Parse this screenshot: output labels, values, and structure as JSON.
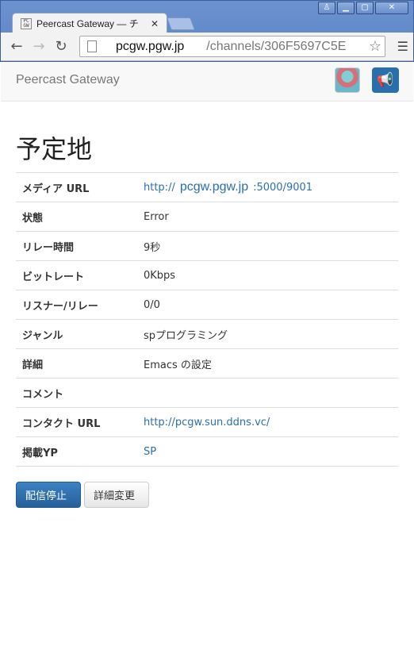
{
  "browser": {
    "tab_title": "Peercast Gateway — チ",
    "tab_favicon_text": "PC GW",
    "omnibox_host": "pcgw.pgw.jp",
    "omnibox_path": "/channels/306F5697C5E"
  },
  "navbar": {
    "brand": "Peercast Gateway"
  },
  "page": {
    "title": "予定地"
  },
  "info": {
    "media_url": {
      "label": "メディア URL",
      "prefix": "http://",
      "host": "pcgw.pgw.jp",
      "suffix": ":5000/9001"
    },
    "status": {
      "label": "状態",
      "value": "Error"
    },
    "relay_time": {
      "label": "リレー時間",
      "value": "9秒"
    },
    "bitrate": {
      "label": "ビットレート",
      "value": "0Kbps"
    },
    "listeners": {
      "label": "リスナー/リレー",
      "value": "0/0"
    },
    "genre": {
      "label": "ジャンル",
      "value": "spプログラミング"
    },
    "detail": {
      "label": "詳細",
      "value": "Emacs の設定"
    },
    "comment": {
      "label": "コメント",
      "value": ""
    },
    "contact_url": {
      "label": "コンタクト URL",
      "value": "http://pcgw.sun.ddns.vc/"
    },
    "yp": {
      "label": "掲載YP",
      "value": "SP"
    }
  },
  "actions": {
    "stop_label": "配信停止",
    "edit_label": "詳細変更"
  },
  "colors": {
    "link": "#2a6fad",
    "primary": "#2a6fad",
    "chrome": "#5a82c4"
  },
  "icons": {
    "back": "arrow-left-icon",
    "forward": "arrow-right-icon",
    "reload": "reload-icon",
    "star": "star-icon",
    "menu": "hamburger-menu-icon",
    "announce": "megaphone-icon"
  }
}
